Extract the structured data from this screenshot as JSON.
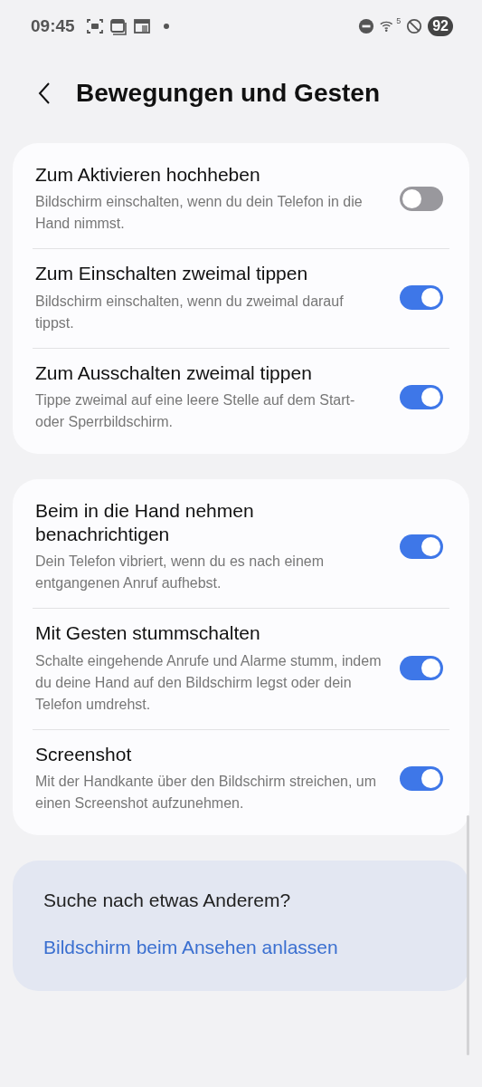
{
  "status_bar": {
    "time": "09:45",
    "network_label": "5",
    "battery": "92"
  },
  "header": {
    "title": "Bewegungen und Gesten"
  },
  "groups": [
    {
      "items": [
        {
          "title": "Zum Aktivieren hochheben",
          "description": "Bildschirm einschalten, wenn du dein Telefon in die Hand nimmst.",
          "on": false
        },
        {
          "title": "Zum Einschalten zweimal tippen",
          "description": "Bildschirm einschalten, wenn du zweimal darauf tippst.",
          "on": true
        },
        {
          "title": "Zum Ausschalten zweimal tippen",
          "description": "Tippe zweimal auf eine leere Stelle auf dem Start- oder Sperrbildschirm.",
          "on": true
        }
      ]
    },
    {
      "items": [
        {
          "title": "Beim in die Hand nehmen benachrichtigen",
          "description": "Dein Telefon vibriert, wenn du es nach einem entgangenen Anruf aufhebst.",
          "on": true
        },
        {
          "title": "Mit Gesten stummschalten",
          "description": "Schalte eingehende Anrufe und Alarme stumm, indem du deine Hand auf den Bildschirm legst oder dein Telefon umdrehst.",
          "on": true
        },
        {
          "title": "Screenshot",
          "description": "Mit der Handkante über den Bildschirm streichen, um einen Screenshot aufzunehmen.",
          "on": true
        }
      ]
    }
  ],
  "suggestions": {
    "heading": "Suche nach etwas Anderem?",
    "links": [
      "Bildschirm beim Ansehen anlassen"
    ]
  }
}
